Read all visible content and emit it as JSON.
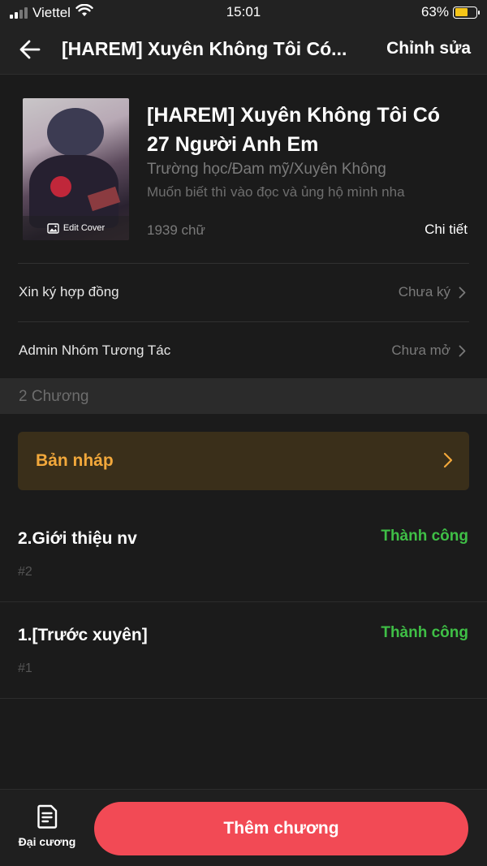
{
  "status_bar": {
    "carrier": "Viettel",
    "time": "15:01",
    "battery_percent": "63%",
    "battery_level": 0.63
  },
  "nav": {
    "title": "[HAREM] Xuyên Không Tôi Có...",
    "edit_label": "Chỉnh sửa"
  },
  "book": {
    "title": "[HAREM] Xuyên Không Tôi Có 27 Người Anh Em",
    "genres": "Trường học/Đam mỹ/Xuyên Không",
    "description": "Muốn biết thì vào đọc và ủng hộ mình nha",
    "word_count": "1939 chữ",
    "detail_label": "Chi tiết",
    "cover_label": "Edit Cover"
  },
  "settings": [
    {
      "label": "Xin ký hợp đồng",
      "value": "Chưa ký"
    },
    {
      "label": "Admin Nhóm Tương Tác",
      "value": "Chưa mở"
    }
  ],
  "section": {
    "title": "2 Chương"
  },
  "drafts": {
    "label": "Bản nháp"
  },
  "chapters": [
    {
      "title": "2.Giới thiệu nv",
      "status": "Thành công",
      "number": "#2"
    },
    {
      "title": "1.[Trước xuyên]",
      "status": "Thành công",
      "number": "#1"
    }
  ],
  "bottom": {
    "outline_label": "Đại cương",
    "add_chapter_label": "Thêm chương"
  },
  "colors": {
    "background": "#1b1b1b",
    "accent_red": "#f24a55",
    "draft_orange": "#f2a83b",
    "success_green": "#3fbf46"
  },
  "icons": [
    "signal-icon",
    "wifi-icon",
    "battery-icon",
    "back-arrow-icon",
    "image-icon",
    "chevron-right-icon",
    "document-icon"
  ]
}
